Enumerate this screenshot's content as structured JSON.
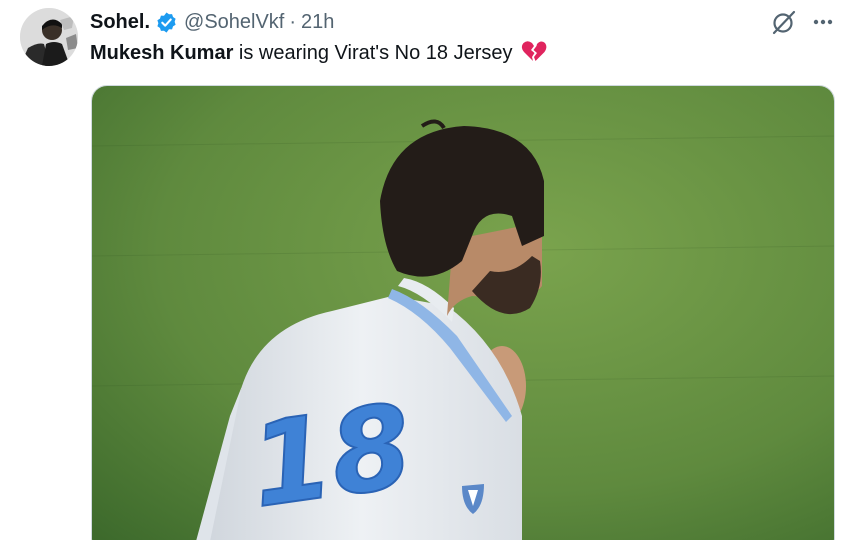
{
  "tweet": {
    "display_name": "Sohel.",
    "handle": "@SohelVkf",
    "separator": "·",
    "timestamp": "21h",
    "verified": true,
    "text_mention": "Mukesh Kumar",
    "text_rest": " is wearing Virat's No 18 Jersey",
    "text_emoji": "broken-heart-icon"
  },
  "media": {
    "jersey_number": "18"
  },
  "colors": {
    "verified_blue": "#1d9bf0",
    "secondary_text": "#536471",
    "heart_red": "#e0245e",
    "pitch_green": "#5f8a3e"
  }
}
